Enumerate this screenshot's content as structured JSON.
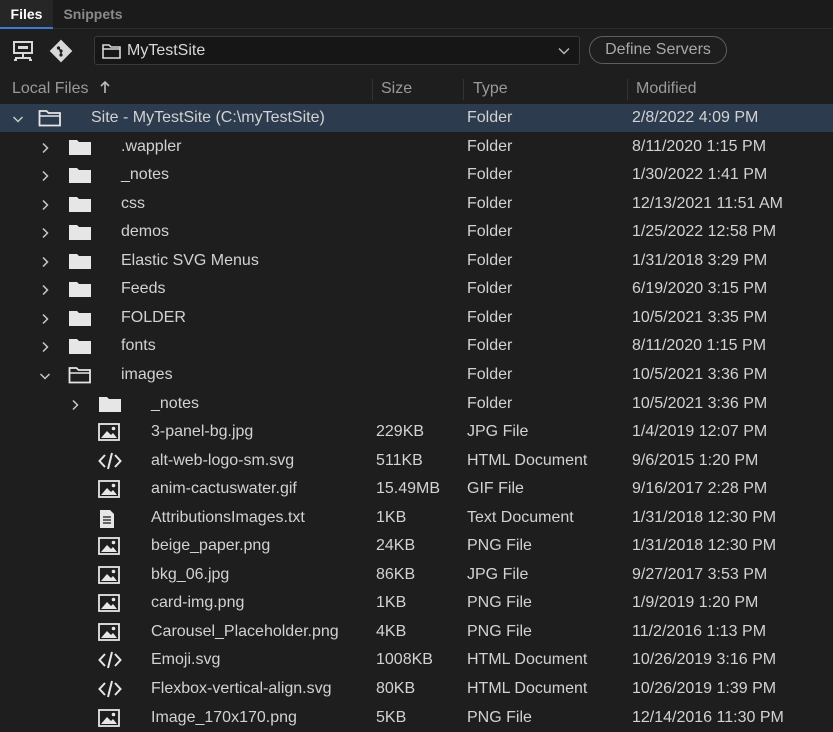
{
  "tabs": [
    {
      "label": "Files",
      "active": true
    },
    {
      "label": "Snippets",
      "active": false
    }
  ],
  "toolbar": {
    "connect_icon": "server-connect-icon",
    "git_icon": "git-icon",
    "site_select": {
      "value": "MyTestSite",
      "icon": "folder-icon"
    },
    "define_servers_label": "Define Servers"
  },
  "columns": {
    "name": "Local Files",
    "size": "Size",
    "type": "Type",
    "modified": "Modified"
  },
  "colors": {
    "selected_row": "#2c3b4e",
    "active_tab_underline": "#3b7bd4",
    "background": "#1e1e1e"
  },
  "rows": [
    {
      "name": "Site - MyTestSite (C:\\myTestSite)",
      "size": "",
      "type": "Folder",
      "modified": "2/8/2022 4:09 PM",
      "depth": 0,
      "kind": "folder",
      "expanded": true,
      "selected": true
    },
    {
      "name": ".wappler",
      "size": "",
      "type": "Folder",
      "modified": "8/11/2020 1:15 PM",
      "depth": 1,
      "kind": "folder",
      "expanded": false
    },
    {
      "name": "_notes",
      "size": "",
      "type": "Folder",
      "modified": "1/30/2022 1:41 PM",
      "depth": 1,
      "kind": "folder",
      "expanded": false
    },
    {
      "name": "css",
      "size": "",
      "type": "Folder",
      "modified": "12/13/2021 11:51 AM",
      "depth": 1,
      "kind": "folder",
      "expanded": false
    },
    {
      "name": "demos",
      "size": "",
      "type": "Folder",
      "modified": "1/25/2022 12:58 PM",
      "depth": 1,
      "kind": "folder",
      "expanded": false
    },
    {
      "name": "Elastic SVG Menus",
      "size": "",
      "type": "Folder",
      "modified": "1/31/2018 3:29 PM",
      "depth": 1,
      "kind": "folder",
      "expanded": false
    },
    {
      "name": "Feeds",
      "size": "",
      "type": "Folder",
      "modified": "6/19/2020 3:15 PM",
      "depth": 1,
      "kind": "folder",
      "expanded": false
    },
    {
      "name": "FOLDER",
      "size": "",
      "type": "Folder",
      "modified": "10/5/2021 3:35 PM",
      "depth": 1,
      "kind": "folder",
      "expanded": false
    },
    {
      "name": "fonts",
      "size": "",
      "type": "Folder",
      "modified": "8/11/2020 1:15 PM",
      "depth": 1,
      "kind": "folder",
      "expanded": false
    },
    {
      "name": "images",
      "size": "",
      "type": "Folder",
      "modified": "10/5/2021 3:36 PM",
      "depth": 1,
      "kind": "folder",
      "expanded": true
    },
    {
      "name": "_notes",
      "size": "",
      "type": "Folder",
      "modified": "10/5/2021 3:36 PM",
      "depth": 2,
      "kind": "folder",
      "expanded": false
    },
    {
      "name": "3-panel-bg.jpg",
      "size": "229KB",
      "type": "JPG File",
      "modified": "1/4/2019 12:07 PM",
      "depth": 2,
      "kind": "image"
    },
    {
      "name": "alt-web-logo-sm.svg",
      "size": "511KB",
      "type": "HTML Document",
      "modified": "9/6/2015 1:20 PM",
      "depth": 2,
      "kind": "code"
    },
    {
      "name": "anim-cactuswater.gif",
      "size": "15.49MB",
      "type": "GIF File",
      "modified": "9/16/2017 2:28 PM",
      "depth": 2,
      "kind": "image"
    },
    {
      "name": "AttributionsImages.txt",
      "size": "1KB",
      "type": "Text Document",
      "modified": "1/31/2018 12:30 PM",
      "depth": 2,
      "kind": "text"
    },
    {
      "name": "beige_paper.png",
      "size": "24KB",
      "type": "PNG File",
      "modified": "1/31/2018 12:30 PM",
      "depth": 2,
      "kind": "image"
    },
    {
      "name": "bkg_06.jpg",
      "size": "86KB",
      "type": "JPG File",
      "modified": "9/27/2017 3:53 PM",
      "depth": 2,
      "kind": "image"
    },
    {
      "name": "card-img.png",
      "size": "1KB",
      "type": "PNG File",
      "modified": "1/9/2019 1:20 PM",
      "depth": 2,
      "kind": "image"
    },
    {
      "name": "Carousel_Placeholder.png",
      "size": "4KB",
      "type": "PNG File",
      "modified": "11/2/2016 1:13 PM",
      "depth": 2,
      "kind": "image"
    },
    {
      "name": "Emoji.svg",
      "size": "1008KB",
      "type": "HTML Document",
      "modified": "10/26/2019 3:16 PM",
      "depth": 2,
      "kind": "code"
    },
    {
      "name": "Flexbox-vertical-align.svg",
      "size": "80KB",
      "type": "HTML Document",
      "modified": "10/26/2019 1:39 PM",
      "depth": 2,
      "kind": "code"
    },
    {
      "name": "Image_170x170.png",
      "size": "5KB",
      "type": "PNG File",
      "modified": "12/14/2016 11:30 PM",
      "depth": 2,
      "kind": "image"
    }
  ]
}
